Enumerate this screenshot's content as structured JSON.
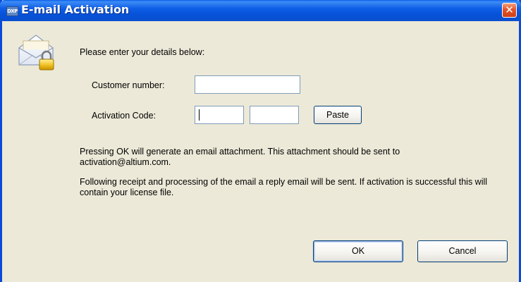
{
  "window": {
    "title": "E-mail Activation",
    "app_icon_text": "DXP",
    "close_glyph": "✕"
  },
  "form": {
    "intro": "Please enter your details below:",
    "customer_number_label": "Customer number:",
    "customer_number_value": "",
    "activation_code_label": "Activation Code:",
    "activation_code_part1_value": "",
    "activation_code_part2_value": "",
    "paste_label": "Paste"
  },
  "info": {
    "paragraph1": "Pressing OK will generate an email attachment. This attachment should be sent to activation@altium.com.",
    "paragraph2": "Following receipt and processing of the email a reply email will be sent. If activation is successful this will contain your license file."
  },
  "buttons": {
    "ok_label": "OK",
    "cancel_label": "Cancel"
  },
  "icons": {
    "main": "envelope-lock-icon",
    "close": "close-icon",
    "app": "app-icon"
  },
  "colors": {
    "title_bar": "#0a5fe8",
    "dialog_bg": "#ece9d8",
    "close_button": "#e2552a",
    "input_border": "#7f9db9",
    "button_border": "#003c74"
  }
}
